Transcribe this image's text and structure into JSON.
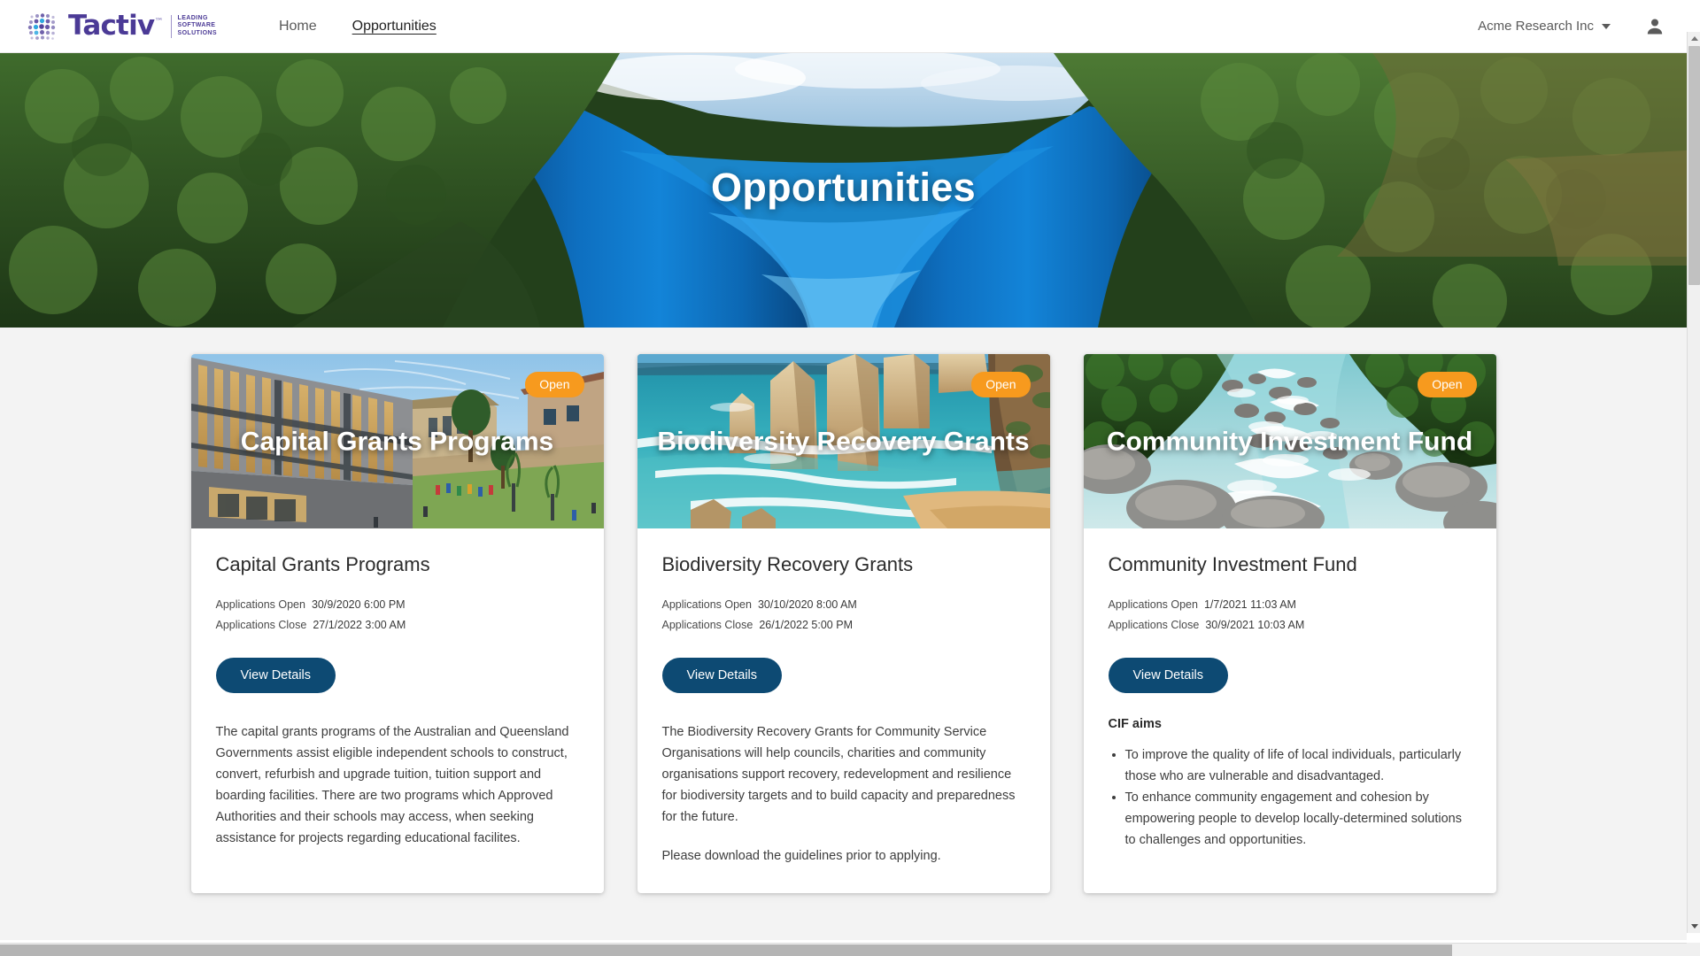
{
  "brand": {
    "name": "Tactiv",
    "tm": "™",
    "tagline_line1": "LEADING",
    "tagline_line2": "SOFTWARE",
    "tagline_line3": "SOLUTIONS",
    "color": "#4b3a96"
  },
  "nav": {
    "items": [
      {
        "label": "Home",
        "active": false
      },
      {
        "label": "Opportunities",
        "active": true
      }
    ]
  },
  "account": {
    "organisation": "Acme Research Inc",
    "dropdown_icon": "chevron-down-icon",
    "avatar_icon": "person-icon"
  },
  "hero": {
    "title": "Opportunities",
    "image_alt": "aerial view of a turquoise river winding through dense green forest"
  },
  "cards": [
    {
      "banner_title": "Capital Grants Programs",
      "status_badge": "Open",
      "image_alt": "modern school building with timber screens and a green lawn",
      "title": "Capital Grants Programs",
      "open_label": "Applications Open",
      "open_value": "30/9/2020 6:00 PM",
      "close_label": "Applications Close",
      "close_value": "27/1/2022 3:00 AM",
      "button_label": "View Details",
      "paragraphs": [
        "The capital grants programs of the Australian and Queensland Governments assist eligible independent schools to construct, convert, refurbish and upgrade tuition, tuition support and boarding facilities. There are two programs which Approved Authorities and their schools may access, when seeking assistance for projects regarding educational facilites."
      ],
      "aims_title": null,
      "aims": []
    },
    {
      "banner_title": "Biodiversity Recovery Grants",
      "status_badge": "Open",
      "image_alt": "limestone sea stacks along a turquoise coastline with sandy beach",
      "title": "Biodiversity Recovery Grants",
      "open_label": "Applications Open",
      "open_value": "30/10/2020 8:00 AM",
      "close_label": "Applications Close",
      "close_value": "26/1/2022 5:00 PM",
      "button_label": "View Details",
      "paragraphs": [
        "The Biodiversity Recovery Grants for Community Service Organisations will help councils, charities and community organisations support recovery, redevelopment and resilience for biodiversity targets and to build capacity and preparedness for the future.",
        "Please download the guidelines prior to applying."
      ],
      "aims_title": null,
      "aims": []
    },
    {
      "banner_title": "Community Investment Fund",
      "status_badge": "Open",
      "image_alt": "rocky mountain river with rapids surrounded by forest",
      "title": "Community Investment Fund",
      "open_label": "Applications Open",
      "open_value": "1/7/2021 11:03 AM",
      "close_label": "Applications Close",
      "close_value": "30/9/2021 10:03 AM",
      "button_label": "View Details",
      "paragraphs": [],
      "aims_title": "CIF aims",
      "aims": [
        "To improve the quality of life of local individuals, particularly those who are vulnerable and disadvantaged.",
        "To enhance community engagement and cohesion by empowering people to develop locally-determined solutions to challenges and opportunities."
      ]
    }
  ],
  "colors": {
    "badge_open": "#f79a1e",
    "button_primary": "#0d4a73",
    "page_background": "#f3f3f3",
    "brand_purple": "#4b3a96"
  }
}
